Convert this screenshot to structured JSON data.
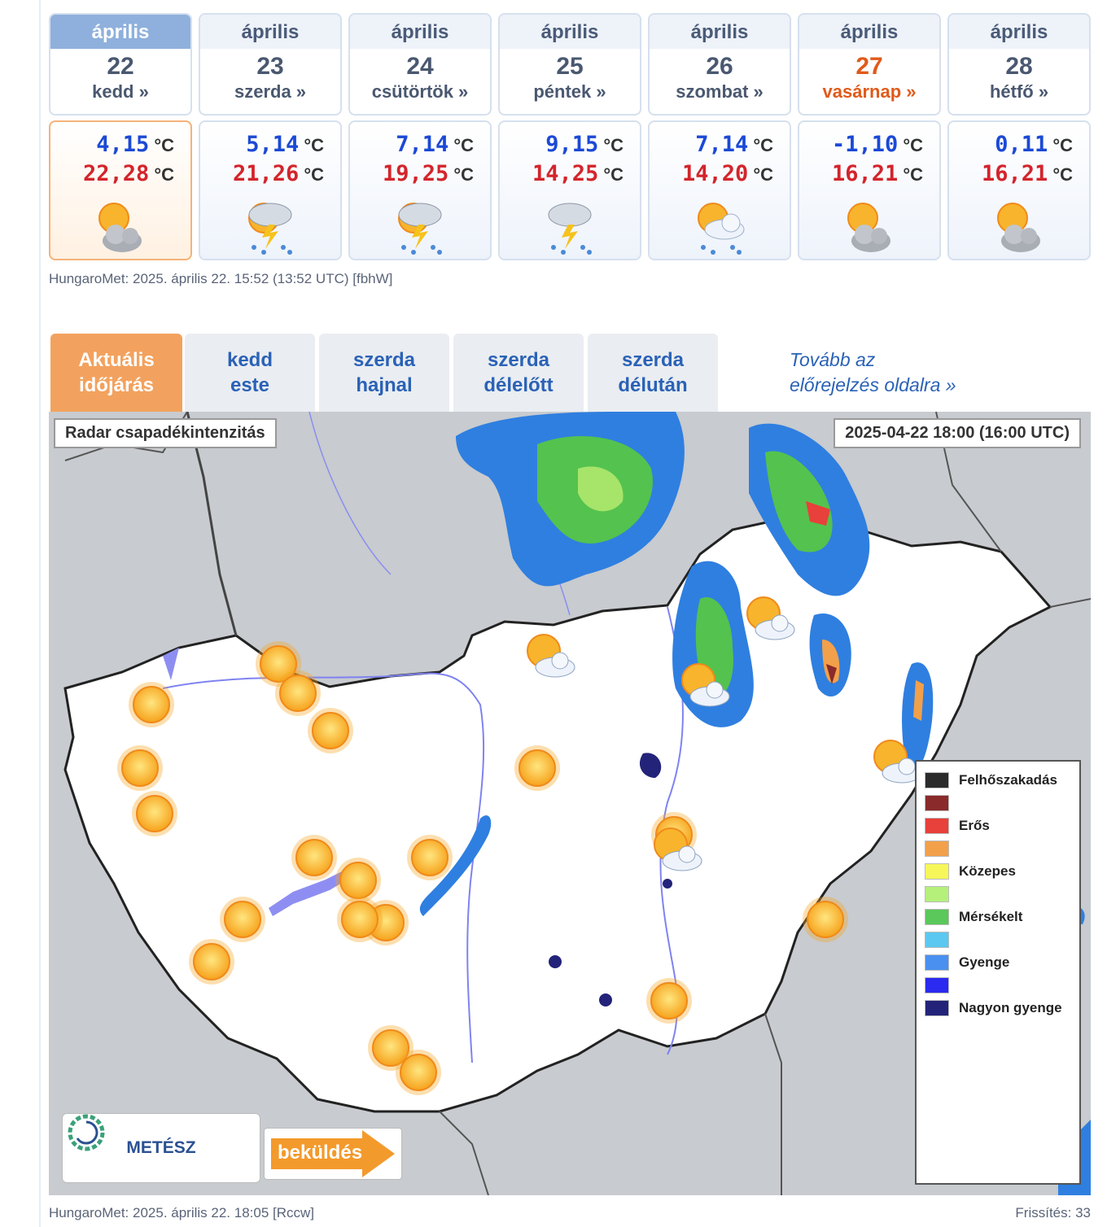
{
  "forecast": {
    "days": [
      {
        "month": "április",
        "day": "22",
        "weekday": "kedd »",
        "tmin": "4,15",
        "tmax": "22,28",
        "icon": "sun-cloud-icon"
      },
      {
        "month": "április",
        "day": "23",
        "weekday": "szerda »",
        "tmin": "5,14",
        "tmax": "21,26",
        "icon": "sun-storm-rain-icon"
      },
      {
        "month": "április",
        "day": "24",
        "weekday": "csütörtök »",
        "tmin": "7,14",
        "tmax": "19,25",
        "icon": "sun-storm-rain-icon"
      },
      {
        "month": "április",
        "day": "25",
        "weekday": "péntek »",
        "tmin": "9,15",
        "tmax": "14,25",
        "icon": "storm-rain-icon"
      },
      {
        "month": "április",
        "day": "26",
        "weekday": "szombat »",
        "tmin": "7,14",
        "tmax": "14,20",
        "icon": "sun-rain-icon"
      },
      {
        "month": "április",
        "day": "27",
        "weekday": "vasárnap »",
        "tmin": "-1,10",
        "tmax": "16,21",
        "icon": "sun-cloud-icon"
      },
      {
        "month": "április",
        "day": "28",
        "weekday": "hétfő »",
        "tmin": "0,11",
        "tmax": "16,21",
        "icon": "sun-cloud-icon"
      }
    ],
    "unit": "°C",
    "meta": "HungaroMet: 2025. április 22. 15:52 (13:52  UTC)  [fbhW]"
  },
  "tabs": [
    {
      "line1": "Aktuális",
      "line2": "időjárás",
      "active": true
    },
    {
      "line1": "kedd",
      "line2": "este",
      "active": false
    },
    {
      "line1": "szerda",
      "line2": "hajnal",
      "active": false
    },
    {
      "line1": "szerda",
      "line2": "délelőtt",
      "active": false
    },
    {
      "line1": "szerda",
      "line2": "délután",
      "active": false
    }
  ],
  "more_link": {
    "line1": "Tovább az",
    "line2": "előrejelzés oldalra »"
  },
  "map": {
    "label": "Radar csapadékintenzitás",
    "timestamp": "2025-04-22 18:00 (16:00 UTC)",
    "legend": [
      {
        "label": "Felhőszakadás",
        "color": "#2b2b2b"
      },
      {
        "label": "",
        "color": "#8a2a2a"
      },
      {
        "label": "Erős",
        "color": "#e8403a"
      },
      {
        "label": "",
        "color": "#f2a04a"
      },
      {
        "label": "Közepes",
        "color": "#f6f65a"
      },
      {
        "label": "",
        "color": "#b4f07a"
      },
      {
        "label": "Mérsékelt",
        "color": "#5ac85a"
      },
      {
        "label": "",
        "color": "#5ac8f0"
      },
      {
        "label": "Gyenge",
        "color": "#4a90f0"
      },
      {
        "label": "",
        "color": "#2a2af0"
      },
      {
        "label": "Nagyon gyenge",
        "color": "#23237a"
      }
    ],
    "logo": {
      "left": "MET",
      "right": "ÉSZ"
    },
    "send_label": "beküldés"
  },
  "footer": {
    "meta": "HungaroMet: 2025. április 22. 18:05 [Rccw]",
    "refresh": "Frissítés: 33"
  }
}
